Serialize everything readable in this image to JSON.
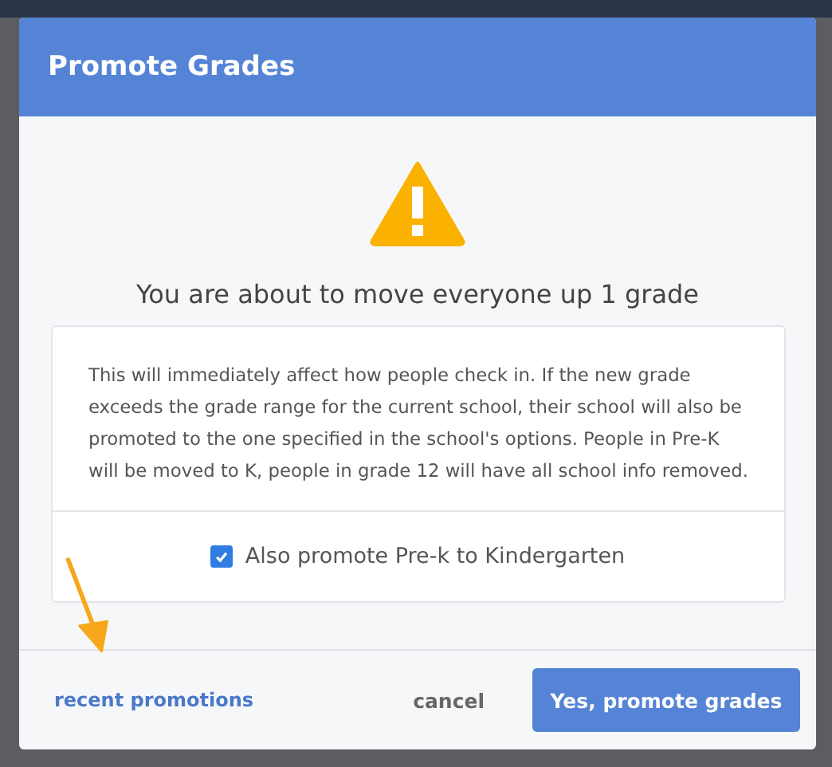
{
  "dialog": {
    "title": "Promote Grades",
    "heading": "You are about to move everyone up 1 grade",
    "message": "This will immediately affect how people check in. If the new grade exceeds the grade range for the current school, their school will also be promoted to the one specified in the school's options. People in Pre-K will be moved to K, people in grade 12 will have all school info removed.",
    "option": {
      "label": "Also promote Pre-k to Kindergarten",
      "checked": true
    },
    "link": "recent promotions",
    "buttons": [
      {
        "label": "cancel",
        "kind": "plain"
      },
      {
        "label": "Yes, promote grades",
        "kind": "primary"
      }
    ]
  }
}
